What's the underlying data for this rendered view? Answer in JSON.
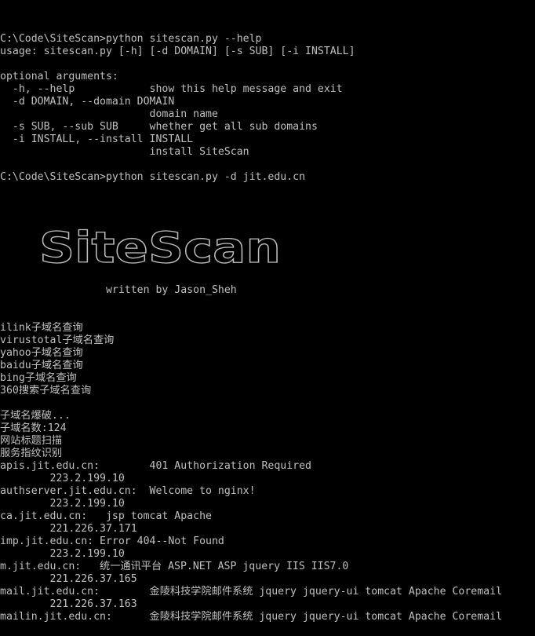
{
  "terminal": {
    "lines_before_banner": [
      "C:\\Code\\SiteScan>python sitescan.py --help",
      "usage: sitescan.py [-h] [-d DOMAIN] [-s SUB] [-i INSTALL]",
      "",
      "optional arguments:",
      "  -h, --help            show this help message and exit",
      "  -d DOMAIN, --domain DOMAIN",
      "                        domain name",
      "  -s SUB, --sub SUB     whether get all sub domains",
      "  -i INSTALL, --install INSTALL",
      "                        install SiteScan",
      "",
      "C:\\Code\\SiteScan>python sitescan.py -d jit.edu.cn"
    ],
    "banner_text": "SiteScan",
    "banner_credit": "                 written by Jason_Sheh",
    "lines_after_banner": [
      "ilink子域名查询",
      "virustotal子域名查询",
      "yahoo子域名查询",
      "baidu子域名查询",
      "bing子域名查询",
      "360搜索子域名查询",
      "",
      "子域名爆破...",
      "子域名数:124",
      "网站标题扫描",
      "服务指纹识别",
      "apis.jit.edu.cn:        401 Authorization Required",
      "        223.2.199.10",
      "authserver.jit.edu.cn:  Welcome to nginx!",
      "        223.2.199.10",
      "ca.jit.edu.cn:   jsp tomcat Apache",
      "        221.226.37.171",
      "imp.jit.edu.cn: Error 404--Not Found",
      "        223.2.199.10",
      "m.jit.edu.cn:   统一通讯平台 ASP.NET ASP jquery IIS IIS7.0",
      "        221.226.37.165",
      "mail.jit.edu.cn:        金陵科技学院邮件系统 jquery jquery-ui tomcat Apache Coremail",
      "        221.226.37.163",
      "mailin.jit.edu.cn:      金陵科技学院邮件系统 jquery jquery-ui tomcat Apache Coremail"
    ]
  }
}
